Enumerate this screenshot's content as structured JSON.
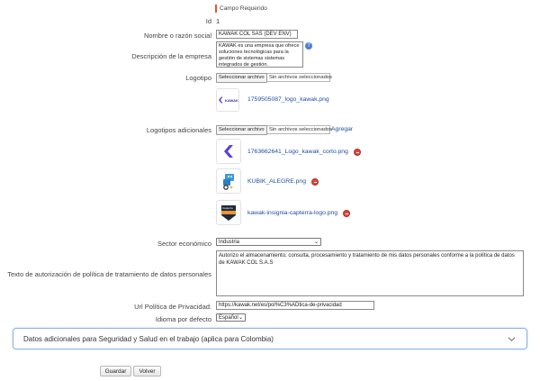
{
  "required_note": "Campo Requerido",
  "fields": {
    "id": {
      "label": "Id",
      "value": "1"
    },
    "name": {
      "label": "Nombre o razón social",
      "value": "KAWAK COL SAS (DEV ENV)"
    },
    "description": {
      "label": "Descripción de la empresa",
      "value": "KAWAK es una empresa que ofrece soluciones tecnológicas para la gestión de sistemas sistemas integrados de gestión."
    },
    "logo": {
      "label": "Logotipo",
      "button": "Seleccionar archivo",
      "status": "Sin archivos seleccionados",
      "current_file": "1759505087_logo_kawak.png",
      "thumb_text": "KAWAK"
    },
    "extra_logos": {
      "label": "Logotipos adicionales",
      "button": "Seleccionar archivo",
      "status": "Sin archivos seleccionados",
      "add_link": "Agregar",
      "files": [
        {
          "name": "1763662641_Logo_kawak_corto.png",
          "icon": "kawak-k-icon"
        },
        {
          "name": "KUBIK_ALEGRE.png",
          "icon": "kubik-robot-icon"
        },
        {
          "name": "kawak-insignia-capterra-logo.png",
          "icon": "capterra-badge-icon",
          "thumb_text": "Capterra"
        }
      ]
    },
    "sector": {
      "label": "Sector económico",
      "value": "Industria"
    },
    "consent": {
      "label": "Texto de autorización de política de tratamiento de datos personales",
      "value": "Autorizo el almacenamiento, consulta, procesamiento y tratamiento de mis datos personales conforme a la política de datos de KAWAK COL S.A.S"
    },
    "privacy_url": {
      "label": "Url Política de Privacidad:",
      "value": "https://kawak.net/es/pol%C3%ADtica-de-privacidad"
    },
    "language": {
      "label": "Idioma por defecto",
      "value": "Español"
    }
  },
  "accordion": {
    "title": "Datos adicionales para Seguridad y Salud en el trabajo (aplica para Colombia)"
  },
  "buttons": {
    "save": "Guardar",
    "back": "Volver"
  },
  "colors": {
    "required_bar": "#e05a2b",
    "link": "#1f4fa0",
    "accordion_border": "#8ab4e6",
    "delete_icon": "#e0463f",
    "brand_purple": "#5b3fd6"
  }
}
